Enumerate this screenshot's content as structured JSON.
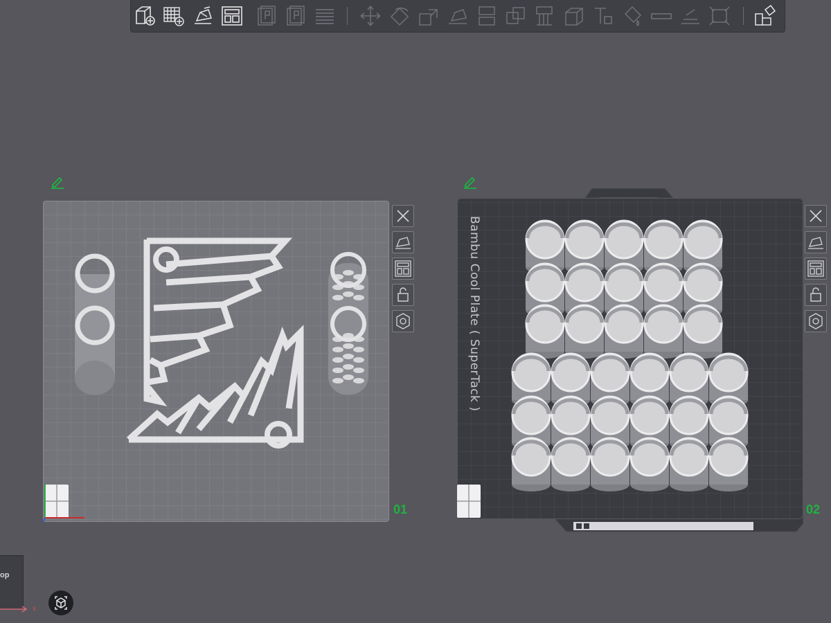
{
  "toolbar": {
    "groups": [
      [
        "add-object",
        "add-plate",
        "auto-orient",
        "arrange"
      ],
      [
        "split-to-objects",
        "split-to-parts",
        "layers-editing"
      ],
      [
        "move",
        "rotate",
        "scale",
        "lay-on-face",
        "cut",
        "boolean",
        "support-painting",
        "seam-painting",
        "text-shape",
        "color-painting",
        "measure",
        "assembly",
        "auto-fit"
      ],
      [
        "assembly-view"
      ]
    ]
  },
  "plates": [
    {
      "number": "01",
      "label": "",
      "actions": [
        "close",
        "auto-orient",
        "arrange",
        "lock",
        "settings"
      ]
    },
    {
      "number": "02",
      "label": "Bambu Cool Plate ( SuperTack )",
      "actions": [
        "close",
        "auto-orient",
        "arrange",
        "lock",
        "settings"
      ]
    }
  ],
  "bottom_panel": {
    "text": "op"
  },
  "axis_label": "x",
  "colors": {
    "background": "#56565c",
    "plate1": "#74757b",
    "plate2": "#3a3b40",
    "plate_number": "#1fb33f",
    "model": "#d9d9d9"
  }
}
